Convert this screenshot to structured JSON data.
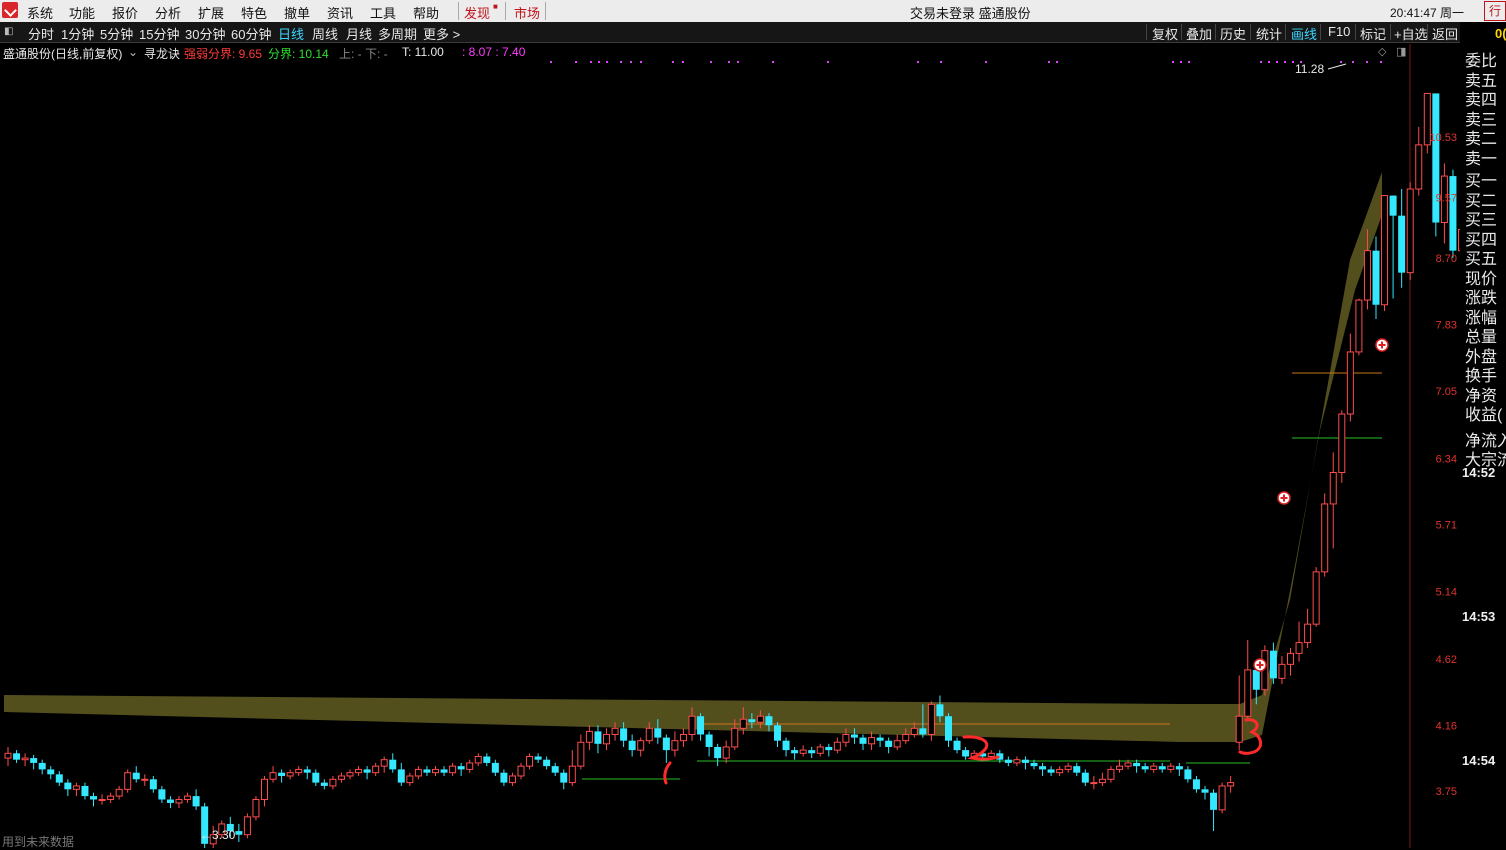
{
  "menubar": {
    "items": [
      "系统",
      "功能",
      "报价",
      "分析",
      "扩展",
      "特色",
      "撤单",
      "资讯",
      "工具",
      "帮助"
    ],
    "discover": "发现",
    "market": "市场",
    "status_text": "交易未登录  盛通股份",
    "clock": "20:41:47 周一",
    "trade_button": "行"
  },
  "periodbar": {
    "periods": [
      "分时",
      "1分钟",
      "5分钟",
      "15分钟",
      "30分钟",
      "60分钟",
      "日线",
      "周线",
      "月线",
      "多周期",
      "更多 >"
    ],
    "active_period": "日线",
    "tools": [
      "复权",
      "叠加",
      "历史",
      "统计",
      "画线",
      "F10",
      "标记",
      "+自选",
      "返回"
    ],
    "active_tool": "画线"
  },
  "infobar": {
    "stock": "盛通股份(日线,前复权)",
    "indicator": "寻龙诀",
    "strong_weak": "强弱分界: 9.65",
    "divide": "分界: 10.14",
    "up_down": "上: -  下: -",
    "t_value": "T: 11.00",
    "extra": ": 8.07 : 7.40"
  },
  "sidepanel": {
    "labels": [
      "委比",
      "卖五",
      "卖四",
      "卖三",
      "卖二",
      "卖一",
      "买一",
      "买二",
      "买三",
      "买四",
      "买五",
      "现价",
      "涨跌",
      "涨幅",
      "总量",
      "外盘",
      "换手",
      "净资",
      "收益(",
      "净流入",
      "大宗流"
    ],
    "times": [
      "14:52",
      "14:53",
      "14:54"
    ],
    "corner": "0("
  },
  "footer": "用到未来数据",
  "colors": {
    "up": "#ff4c4c",
    "down": "#33e8ff",
    "band": "#5a5620",
    "green_line": "#26c026",
    "axis_text": "#e0342e"
  },
  "chart_data": {
    "type": "candlestick",
    "y_axis_ticks": [
      10.53,
      9.57,
      8.7,
      7.83,
      7.05,
      6.34,
      5.71,
      5.14,
      4.62,
      4.16,
      3.75
    ],
    "annotations": {
      "high_label": "11.28",
      "low_label": "3.30"
    },
    "candles": [
      [
        3.95,
        3.98,
        3.9,
        4.02
      ],
      [
        3.98,
        3.94,
        3.92,
        4.0
      ],
      [
        3.94,
        3.95,
        3.9,
        3.98
      ],
      [
        3.95,
        3.92,
        3.88,
        3.97
      ],
      [
        3.92,
        3.88,
        3.85,
        3.94
      ],
      [
        3.88,
        3.85,
        3.82,
        3.9
      ],
      [
        3.85,
        3.8,
        3.78,
        3.87
      ],
      [
        3.8,
        3.76,
        3.72,
        3.82
      ],
      [
        3.76,
        3.78,
        3.72,
        3.8
      ],
      [
        3.78,
        3.72,
        3.7,
        3.8
      ],
      [
        3.72,
        3.7,
        3.66,
        3.74
      ],
      [
        3.7,
        3.7,
        3.67,
        3.73
      ],
      [
        3.7,
        3.72,
        3.68,
        3.74
      ],
      [
        3.72,
        3.76,
        3.7,
        3.78
      ],
      [
        3.76,
        3.86,
        3.74,
        3.88
      ],
      [
        3.86,
        3.82,
        3.8,
        3.9
      ],
      [
        3.82,
        3.82,
        3.78,
        3.85
      ],
      [
        3.82,
        3.76,
        3.74,
        3.84
      ],
      [
        3.76,
        3.7,
        3.68,
        3.78
      ],
      [
        3.7,
        3.68,
        3.65,
        3.72
      ],
      [
        3.68,
        3.7,
        3.65,
        3.72
      ],
      [
        3.7,
        3.72,
        3.68,
        3.74
      ],
      [
        3.72,
        3.66,
        3.64,
        3.76
      ],
      [
        3.66,
        3.45,
        3.3,
        3.68
      ],
      [
        3.45,
        3.5,
        3.4,
        3.55
      ],
      [
        3.5,
        3.56,
        3.48,
        3.58
      ],
      [
        3.56,
        3.52,
        3.48,
        3.6
      ],
      [
        3.52,
        3.5,
        3.46,
        3.56
      ],
      [
        3.5,
        3.6,
        3.48,
        3.62
      ],
      [
        3.6,
        3.7,
        3.58,
        3.72
      ],
      [
        3.7,
        3.82,
        3.66,
        3.84
      ],
      [
        3.82,
        3.86,
        3.8,
        3.9
      ],
      [
        3.86,
        3.84,
        3.8,
        3.88
      ],
      [
        3.84,
        3.86,
        3.82,
        3.88
      ],
      [
        3.86,
        3.88,
        3.84,
        3.9
      ],
      [
        3.88,
        3.86,
        3.82,
        3.9
      ],
      [
        3.86,
        3.8,
        3.78,
        3.88
      ],
      [
        3.8,
        3.78,
        3.76,
        3.82
      ],
      [
        3.78,
        3.82,
        3.76,
        3.84
      ],
      [
        3.82,
        3.84,
        3.8,
        3.86
      ],
      [
        3.84,
        3.86,
        3.82,
        3.88
      ],
      [
        3.86,
        3.88,
        3.84,
        3.9
      ],
      [
        3.88,
        3.86,
        3.82,
        3.9
      ],
      [
        3.86,
        3.9,
        3.84,
        3.92
      ],
      [
        3.9,
        3.94,
        3.86,
        3.96
      ],
      [
        3.94,
        3.88,
        3.86,
        3.98
      ],
      [
        3.88,
        3.8,
        3.78,
        3.92
      ],
      [
        3.8,
        3.84,
        3.78,
        3.86
      ],
      [
        3.84,
        3.88,
        3.82,
        3.9
      ],
      [
        3.88,
        3.86,
        3.84,
        3.9
      ],
      [
        3.86,
        3.88,
        3.84,
        3.9
      ],
      [
        3.88,
        3.86,
        3.84,
        3.9
      ],
      [
        3.86,
        3.9,
        3.84,
        3.92
      ],
      [
        3.9,
        3.88,
        3.84,
        3.92
      ],
      [
        3.88,
        3.92,
        3.86,
        3.94
      ],
      [
        3.92,
        3.96,
        3.9,
        3.98
      ],
      [
        3.96,
        3.92,
        3.9,
        3.98
      ],
      [
        3.92,
        3.86,
        3.84,
        3.94
      ],
      [
        3.86,
        3.8,
        3.78,
        3.88
      ],
      [
        3.8,
        3.84,
        3.78,
        3.86
      ],
      [
        3.84,
        3.9,
        3.82,
        3.92
      ],
      [
        3.9,
        3.96,
        3.88,
        3.98
      ],
      [
        3.96,
        3.94,
        3.92,
        3.98
      ],
      [
        3.94,
        3.9,
        3.88,
        3.96
      ],
      [
        3.9,
        3.86,
        3.84,
        3.92
      ],
      [
        3.86,
        3.8,
        3.76,
        3.88
      ],
      [
        3.8,
        3.9,
        3.78,
        4.0
      ],
      [
        3.9,
        4.05,
        3.88,
        4.1
      ],
      [
        4.05,
        4.12,
        4.0,
        4.16
      ],
      [
        4.12,
        4.04,
        3.98,
        4.16
      ],
      [
        4.04,
        4.1,
        4.0,
        4.14
      ],
      [
        4.1,
        4.14,
        4.06,
        4.18
      ],
      [
        4.14,
        4.06,
        4.02,
        4.18
      ],
      [
        4.06,
        4.0,
        3.96,
        4.1
      ],
      [
        4.0,
        4.06,
        3.96,
        4.08
      ],
      [
        4.06,
        4.14,
        4.04,
        4.18
      ],
      [
        4.14,
        4.08,
        4.04,
        4.2
      ],
      [
        4.08,
        4.0,
        3.92,
        4.1
      ],
      [
        4.0,
        4.06,
        3.96,
        4.12
      ],
      [
        4.06,
        4.1,
        4.02,
        4.14
      ],
      [
        4.1,
        4.22,
        4.06,
        4.28
      ],
      [
        4.22,
        4.1,
        4.06,
        4.24
      ],
      [
        4.1,
        4.02,
        3.96,
        4.12
      ],
      [
        4.02,
        3.95,
        3.9,
        4.04
      ],
      [
        3.95,
        4.02,
        3.92,
        4.06
      ],
      [
        4.02,
        4.14,
        4.0,
        4.2
      ],
      [
        4.14,
        4.2,
        4.1,
        4.28
      ],
      [
        4.2,
        4.18,
        4.14,
        4.24
      ],
      [
        4.18,
        4.22,
        4.14,
        4.26
      ],
      [
        4.22,
        4.16,
        4.12,
        4.24
      ],
      [
        4.16,
        4.06,
        4.02,
        4.18
      ],
      [
        4.06,
        4.0,
        3.96,
        4.08
      ],
      [
        4.0,
        3.98,
        3.94,
        4.02
      ],
      [
        3.98,
        4.0,
        3.96,
        4.03
      ],
      [
        4.0,
        3.98,
        3.95,
        4.02
      ],
      [
        3.98,
        4.02,
        3.96,
        4.04
      ],
      [
        4.02,
        4.0,
        3.96,
        4.04
      ],
      [
        4.0,
        4.05,
        3.98,
        4.08
      ],
      [
        4.05,
        4.1,
        4.02,
        4.14
      ],
      [
        4.1,
        4.08,
        4.04,
        4.14
      ],
      [
        4.08,
        4.04,
        4.0,
        4.1
      ],
      [
        4.04,
        4.08,
        4.0,
        4.12
      ],
      [
        4.08,
        4.06,
        4.02,
        4.1
      ],
      [
        4.06,
        4.02,
        3.98,
        4.08
      ],
      [
        4.02,
        4.06,
        4.0,
        4.1
      ],
      [
        4.06,
        4.1,
        4.04,
        4.14
      ],
      [
        4.1,
        4.14,
        4.08,
        4.18
      ],
      [
        4.14,
        4.1,
        4.08,
        4.3
      ],
      [
        4.1,
        4.3,
        4.06,
        4.32
      ],
      [
        4.3,
        4.22,
        4.18,
        4.36
      ],
      [
        4.22,
        4.06,
        4.02,
        4.24
      ],
      [
        4.06,
        4.0,
        3.98,
        4.08
      ],
      [
        4.0,
        3.96,
        3.94,
        4.02
      ],
      [
        3.96,
        3.98,
        3.94,
        4.0
      ],
      [
        3.98,
        3.96,
        3.93,
        4.0
      ],
      [
        3.96,
        3.98,
        3.94,
        4.0
      ],
      [
        3.98,
        3.94,
        3.92,
        4.0
      ],
      [
        3.94,
        3.92,
        3.9,
        3.96
      ],
      [
        3.92,
        3.94,
        3.9,
        3.96
      ],
      [
        3.94,
        3.92,
        3.88,
        3.96
      ],
      [
        3.92,
        3.9,
        3.88,
        3.94
      ],
      [
        3.9,
        3.88,
        3.84,
        3.92
      ],
      [
        3.88,
        3.86,
        3.84,
        3.9
      ],
      [
        3.86,
        3.88,
        3.84,
        3.9
      ],
      [
        3.88,
        3.9,
        3.86,
        3.92
      ],
      [
        3.9,
        3.86,
        3.84,
        3.92
      ],
      [
        3.86,
        3.8,
        3.78,
        3.88
      ],
      [
        3.8,
        3.8,
        3.76,
        3.84
      ],
      [
        3.8,
        3.82,
        3.78,
        3.86
      ],
      [
        3.82,
        3.88,
        3.8,
        3.9
      ],
      [
        3.88,
        3.9,
        3.86,
        3.94
      ],
      [
        3.9,
        3.92,
        3.88,
        3.94
      ],
      [
        3.92,
        3.9,
        3.86,
        3.94
      ],
      [
        3.9,
        3.88,
        3.86,
        3.92
      ],
      [
        3.88,
        3.9,
        3.86,
        3.92
      ],
      [
        3.9,
        3.88,
        3.86,
        3.92
      ],
      [
        3.88,
        3.9,
        3.86,
        3.92
      ],
      [
        3.9,
        3.88,
        3.84,
        3.92
      ],
      [
        3.88,
        3.82,
        3.8,
        3.9
      ],
      [
        3.82,
        3.76,
        3.74,
        3.84
      ],
      [
        3.76,
        3.74,
        3.7,
        3.78
      ],
      [
        3.74,
        3.64,
        3.52,
        3.76
      ],
      [
        3.64,
        3.78,
        3.62,
        3.8
      ],
      [
        3.78,
        3.8,
        3.74,
        3.84
      ],
      [
        4.05,
        4.22,
        4.0,
        4.5
      ],
      [
        4.22,
        4.54,
        4.2,
        4.76
      ],
      [
        4.54,
        4.4,
        4.3,
        4.6
      ],
      [
        4.4,
        4.68,
        4.36,
        4.72
      ],
      [
        4.68,
        4.48,
        4.44,
        4.74
      ],
      [
        4.48,
        4.58,
        4.44,
        4.64
      ],
      [
        4.58,
        4.66,
        4.5,
        4.7
      ],
      [
        4.66,
        4.74,
        4.6,
        4.9
      ],
      [
        4.74,
        4.88,
        4.7,
        5.0
      ],
      [
        4.88,
        5.3,
        4.86,
        5.34
      ],
      [
        5.3,
        5.9,
        5.26,
        6.0
      ],
      [
        5.9,
        6.2,
        5.5,
        6.4
      ],
      [
        6.2,
        6.8,
        6.1,
        6.84
      ],
      [
        6.8,
        7.5,
        6.72,
        7.72
      ],
      [
        7.5,
        8.14,
        7.46,
        8.16
      ],
      [
        8.14,
        8.8,
        8.02,
        9.1
      ],
      [
        8.8,
        8.08,
        7.9,
        9.0
      ],
      [
        8.08,
        9.6,
        8.0,
        9.6
      ],
      [
        9.6,
        9.3,
        8.16,
        9.6
      ],
      [
        9.3,
        8.5,
        8.3,
        9.7
      ],
      [
        8.5,
        9.7,
        8.4,
        9.8
      ],
      [
        9.7,
        10.4,
        9.6,
        10.7
      ],
      [
        10.4,
        11.28,
        10.26,
        11.28
      ],
      [
        11.28,
        9.2,
        9.0,
        11.28
      ],
      [
        9.2,
        9.9,
        8.9,
        10.1
      ],
      [
        9.9,
        8.8,
        8.7,
        10.0
      ],
      [
        8.8,
        9.1,
        8.6,
        9.4
      ],
      [
        9.1,
        9.6,
        8.9,
        9.7
      ]
    ]
  }
}
